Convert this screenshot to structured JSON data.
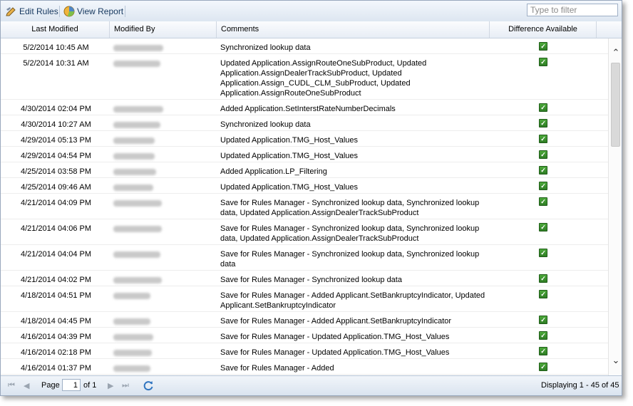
{
  "toolbar": {
    "edit_rules": "Edit Rules",
    "view_report": "View Report",
    "filter_placeholder": "Type to filter"
  },
  "columns": [
    "Last Modified",
    "Modified By",
    "Comments",
    "Difference Available"
  ],
  "rows": [
    {
      "date": "5/2/2014 10:45 AM",
      "comment": [
        "Synchronized lookup data"
      ]
    },
    {
      "date": "5/2/2014 10:31 AM",
      "comment": [
        "Updated Application.AssignRouteOneSubProduct, Updated",
        "Application.AssignDealerTrackSubProduct, Updated",
        "Application.Assign_CUDL_CLM_SubProduct, Updated",
        "Application.AssignRouteOneSubProduct"
      ]
    },
    {
      "date": "4/30/2014 02:04 PM",
      "comment": [
        "Added Application.SetInterstRateNumberDecimals"
      ]
    },
    {
      "date": "4/30/2014 10:27 AM",
      "comment": [
        "Synchronized lookup data"
      ]
    },
    {
      "date": "4/29/2014 05:13 PM",
      "comment": [
        "Updated Application.TMG_Host_Values"
      ]
    },
    {
      "date": "4/29/2014 04:54 PM",
      "comment": [
        "Updated Application.TMG_Host_Values"
      ]
    },
    {
      "date": "4/25/2014 03:58 PM",
      "comment": [
        "Added Application.LP_Filtering"
      ]
    },
    {
      "date": "4/25/2014 09:46 AM",
      "comment": [
        "Updated Application.TMG_Host_Values"
      ]
    },
    {
      "date": "4/21/2014 04:09 PM",
      "comment": [
        "Save for Rules Manager - Synchronized lookup data, Synchronized lookup",
        "data, Updated Application.AssignDealerTrackSubProduct"
      ]
    },
    {
      "date": "4/21/2014 04:06 PM",
      "comment": [
        "Save for Rules Manager - Synchronized lookup data, Synchronized lookup",
        "data, Updated Application.AssignDealerTrackSubProduct"
      ]
    },
    {
      "date": "4/21/2014 04:04 PM",
      "comment": [
        "Save for Rules Manager - Synchronized lookup data, Synchronized lookup",
        "data"
      ]
    },
    {
      "date": "4/21/2014 04:02 PM",
      "comment": [
        "Save for Rules Manager - Synchronized lookup data"
      ]
    },
    {
      "date": "4/18/2014 04:51 PM",
      "comment": [
        "Save for Rules Manager - Added Applicant.SetBankruptcyIndicator, Updated",
        "Applicant.SetBankruptcyIndicator"
      ]
    },
    {
      "date": "4/18/2014 04:45 PM",
      "comment": [
        "Save for Rules Manager - Added Applicant.SetBankruptcyIndicator"
      ]
    },
    {
      "date": "4/16/2014 04:39 PM",
      "comment": [
        "Save for Rules Manager - Updated Application.TMG_Host_Values"
      ]
    },
    {
      "date": "4/16/2014 02:18 PM",
      "comment": [
        "Save for Rules Manager - Updated Application.TMG_Host_Values"
      ]
    },
    {
      "date": "4/16/2014 01:37 PM",
      "comment": [
        "Save for Rules Manager - Added"
      ]
    }
  ],
  "pager": {
    "page_label": "Page",
    "page_value": "1",
    "of_label": "of 1",
    "displaying": "Displaying 1 - 45 of 45"
  }
}
